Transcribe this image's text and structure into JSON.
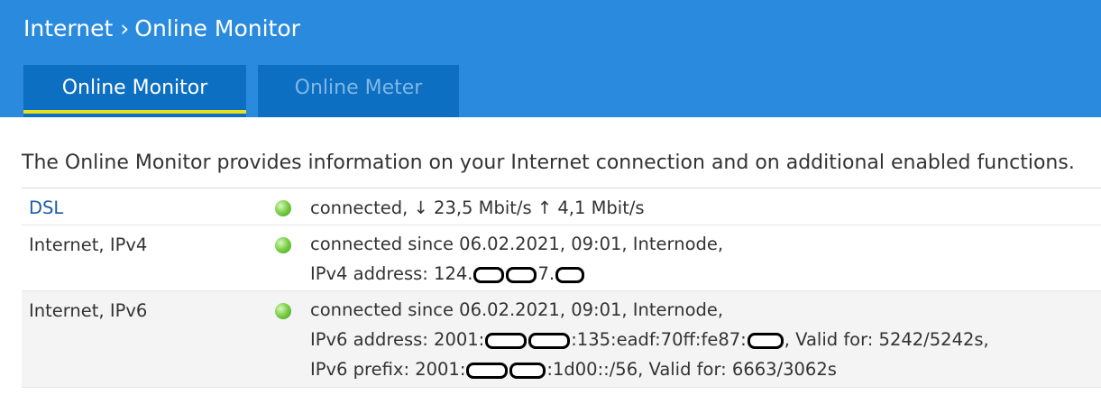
{
  "breadcrumb": {
    "parent": "Internet",
    "separator": "›",
    "current": "Online Monitor"
  },
  "tabs": [
    {
      "label": "Online Monitor",
      "active": true
    },
    {
      "label": "Online Meter",
      "active": false
    }
  ],
  "intro": "The Online Monitor provides information on your Internet connection and on additional enabled functions.",
  "rows": {
    "dsl": {
      "label": "DSL",
      "status": "green",
      "line1": "connected, ↓ 23,5 Mbit/s ↑ 4,1 Mbit/s"
    },
    "ipv4": {
      "label": "Internet, IPv4",
      "status": "green",
      "line1": "connected since 06.02.2021, 09:01, Internode,",
      "addr_prefix": "IPv4 address: 124.",
      "addr_mid": "7."
    },
    "ipv6": {
      "label": "Internet, IPv6",
      "status": "green",
      "line1": "connected since 06.02.2021, 09:01, Internode,",
      "addr_prefix": "IPv6 address: 2001:",
      "addr_mid": ":135:eadf:70ff:fe87:",
      "addr_suffix": ", Valid for: 5242/5242s,",
      "prefix_start": "IPv6 prefix: 2001:",
      "prefix_mid": ":1d00::/56, Valid for: 6663/3062s"
    }
  },
  "colors": {
    "header_bg": "#2a8bde",
    "tab_bg": "#0d6fc2",
    "tab_underline": "#e9e11f",
    "led_green": "#6cc63a"
  }
}
